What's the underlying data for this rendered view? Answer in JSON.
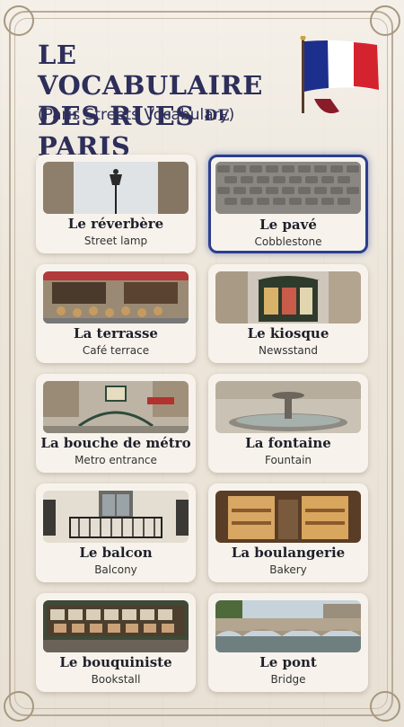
{
  "header": {
    "title_line1": "LE VOCABULAIRE",
    "title_line2_a": "DES RUES ",
    "title_line2_small": "DE",
    "title_line2_b": " PARIS",
    "subtitle": "(Paris Streets Vocabulary)"
  },
  "cards": [
    {
      "fr": "Le réverbère",
      "en": "Street lamp",
      "icon": "street-lamp-photo"
    },
    {
      "fr": "Le pavé",
      "en": "Cobblestone",
      "icon": "cobblestone-photo",
      "selected": true
    },
    {
      "fr": "La terrasse",
      "en": "Café terrace",
      "icon": "cafe-terrace-photo"
    },
    {
      "fr": "Le kiosque",
      "en": "Newsstand",
      "icon": "newsstand-photo"
    },
    {
      "fr": "La bouche de métro",
      "en": "Metro entrance",
      "icon": "metro-entrance-photo"
    },
    {
      "fr": "La fontaine",
      "en": "Fountain",
      "icon": "fountain-photo"
    },
    {
      "fr": "Le balcon",
      "en": "Balcony",
      "icon": "balcony-photo"
    },
    {
      "fr": "La boulangerie",
      "en": "Bakery",
      "icon": "bakery-photo"
    },
    {
      "fr": "Le bouquiniste",
      "en": "Bookstall",
      "icon": "bookstall-photo"
    },
    {
      "fr": "Le pont",
      "en": "Bridge",
      "icon": "bridge-photo"
    }
  ],
  "colors": {
    "accent": "#2c3e8f",
    "title": "#2d2e5a",
    "flag_blue": "#1d2f8c",
    "flag_red": "#d4232f"
  }
}
